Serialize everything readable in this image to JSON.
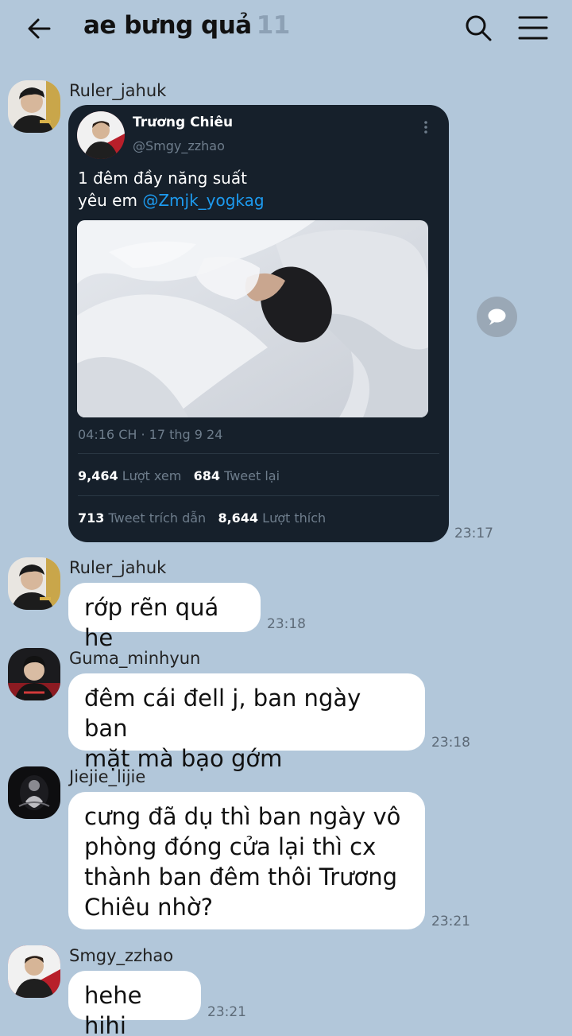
{
  "header": {
    "title": "ae bưng quả",
    "member_count": "11",
    "back_icon": "arrow-left-icon",
    "search_icon": "search-icon",
    "menu_icon": "hamburger-menu-icon"
  },
  "messages": [
    {
      "sender": "Ruler_jahuk",
      "time": "23:17",
      "tweet": {
        "author_name": "Trương Chiêu",
        "author_handle": "@Smgy_zzhao",
        "text_line1": "1 đêm đầy năng suất",
        "text_line2_prefix": "yêu em ",
        "mention": "@Zmjk_yogkag",
        "date": "04:16 CH · 17 thg 9 24",
        "views_count": "9,464",
        "views_label": "Lượt xem",
        "retweets_count": "684",
        "retweets_label": "Tweet lại",
        "quotes_count": "713",
        "quotes_label": "Tweet trích dẫn",
        "likes_count": "8,644",
        "likes_label": "Lượt thích"
      }
    },
    {
      "sender": "Ruler_jahuk",
      "text": "rớp rẽn quá he",
      "time": "23:18"
    },
    {
      "sender": "Guma_minhyun",
      "line1": "đêm cái đell j, ban ngày ban",
      "line2": "mặt mà bạo gớm",
      "time": "23:18"
    },
    {
      "sender": "Jiejie_lijie",
      "line1": "cưng đã dụ thì ban ngày vô",
      "line2": "phòng đóng cửa lại thì cx",
      "line3": "thành ban đêm thôi Trương",
      "line4": "Chiêu nhờ?",
      "time": "23:21"
    },
    {
      "sender": "Smgy_zzhao",
      "text": "hehe hihi",
      "time": "23:21"
    }
  ],
  "colors": {
    "background": "#b2c7da",
    "bubble": "#ffffff",
    "tweet_bg": "#16202b",
    "mention": "#1d9bf0"
  }
}
